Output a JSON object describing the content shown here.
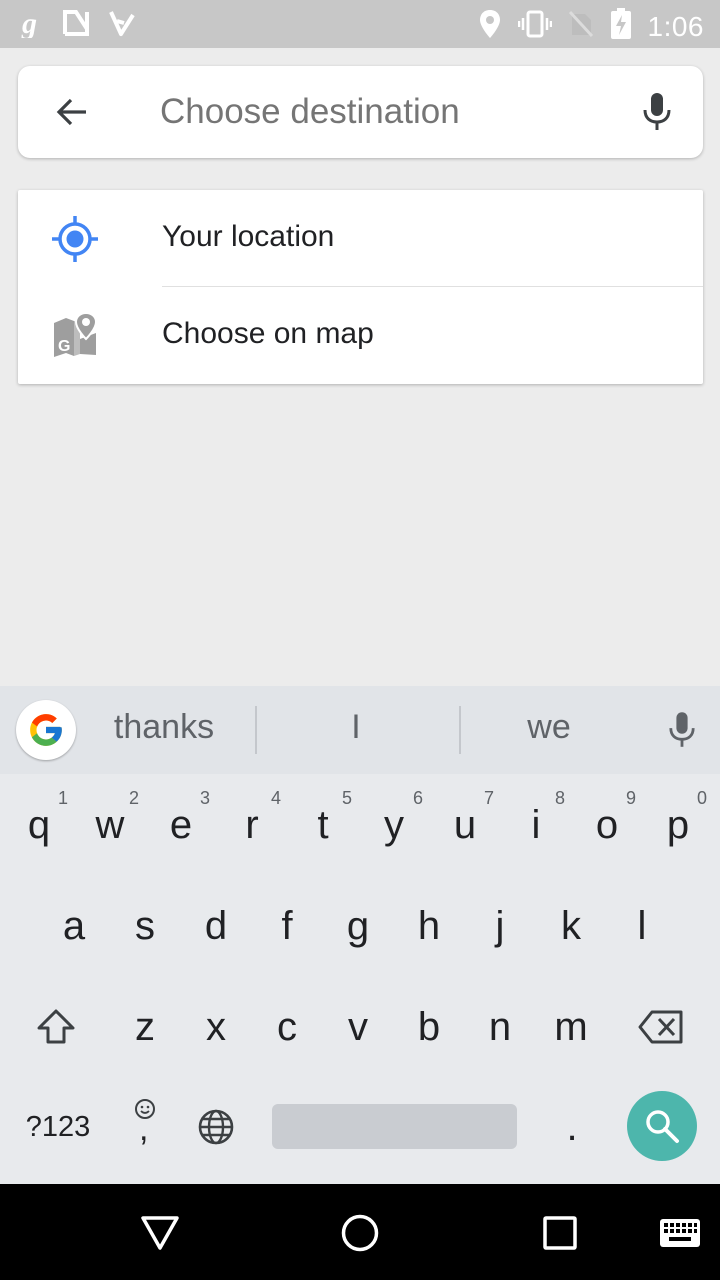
{
  "status_bar": {
    "time": "1:06",
    "left_icons": [
      "g-icon",
      "n-icon",
      "check-icon"
    ],
    "right_icons": [
      "location-icon",
      "vibrate-icon",
      "no-sim-icon",
      "battery-charging-icon"
    ]
  },
  "search": {
    "placeholder": "Choose destination",
    "value": ""
  },
  "options": [
    {
      "label": "Your location",
      "icon": "my-location-icon",
      "icon_color": "#4285f4"
    },
    {
      "label": "Choose on map",
      "icon": "map-pin-icon",
      "icon_color": "#9e9e9e"
    }
  ],
  "keyboard": {
    "suggestions": [
      "thanks",
      "I",
      "we"
    ],
    "row1": [
      {
        "key": "q",
        "hint": "1"
      },
      {
        "key": "w",
        "hint": "2"
      },
      {
        "key": "e",
        "hint": "3"
      },
      {
        "key": "r",
        "hint": "4"
      },
      {
        "key": "t",
        "hint": "5"
      },
      {
        "key": "y",
        "hint": "6"
      },
      {
        "key": "u",
        "hint": "7"
      },
      {
        "key": "i",
        "hint": "8"
      },
      {
        "key": "o",
        "hint": "9"
      },
      {
        "key": "p",
        "hint": "0"
      }
    ],
    "row2": [
      "a",
      "s",
      "d",
      "f",
      "g",
      "h",
      "j",
      "k",
      "l"
    ],
    "row3": [
      "z",
      "x",
      "c",
      "v",
      "b",
      "n",
      "m"
    ],
    "symbols_label": "?123",
    "period_label": ".",
    "comma_label": ","
  },
  "colors": {
    "accent": "#4285f4",
    "search_key": "#4db6ac"
  }
}
